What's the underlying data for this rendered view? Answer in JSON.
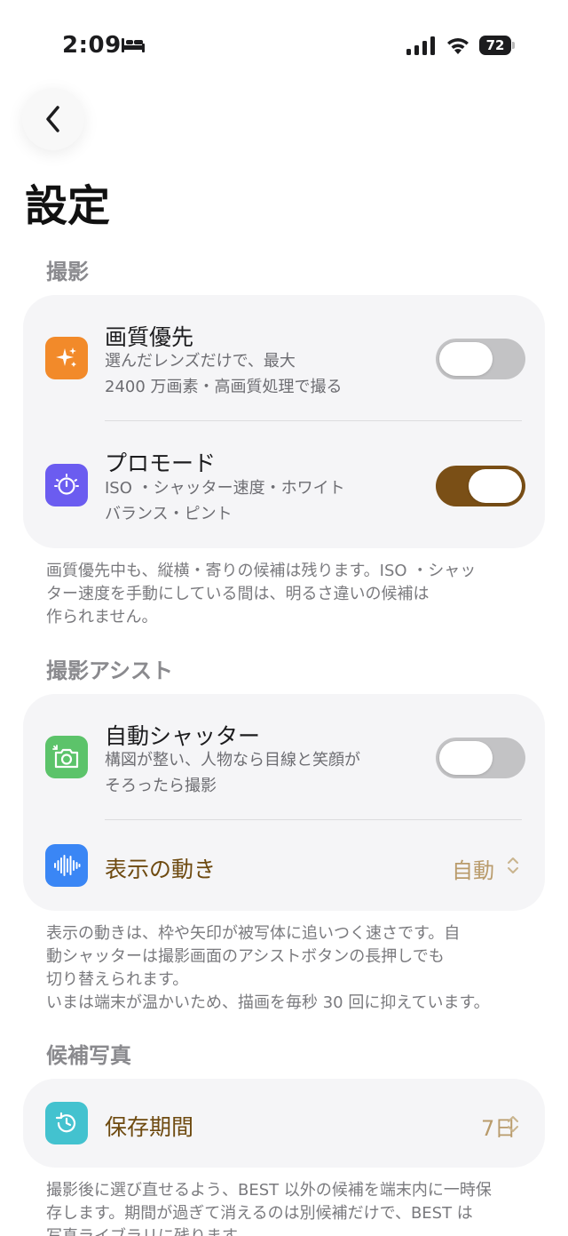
{
  "status_bar": {
    "time": "2:09",
    "battery": "72",
    "icons": [
      "bed-icon",
      "signal-icon",
      "wifi-icon",
      "battery-icon"
    ]
  },
  "back_icon": "chevron-left-icon",
  "page_title": "設定",
  "sections": {
    "shooting": {
      "header": "撮影",
      "items": {
        "quality": {
          "icon": "sparkles-icon",
          "icon_color": "#f28a2a",
          "title": "画質優先",
          "desc_line1": "選んだレンズだけで、最大",
          "desc_line2": "2400 万画素・高画質処理で撮る",
          "enabled": false
        },
        "pro": {
          "icon": "timer-icon",
          "icon_color": "#6b5cf0",
          "title": "プロモード",
          "desc_line1": "ISO ・シャッター速度・ホワイト",
          "desc_line2": "バランス・ピント",
          "enabled": true
        }
      },
      "note_lines": [
        "画質優先中も、縦横・寄りの候補は残ります。ISO ・シャッ",
        "ター速度を手動にしている間は、明るさ違いの候補は",
        "作られません。"
      ]
    },
    "assist": {
      "header": "撮影アシスト",
      "items": {
        "auto_shutter": {
          "icon": "camera-icon",
          "icon_color": "#5cc36a",
          "title": "自動シャッター",
          "desc_line1": "構図が整い、人物なら目線と笑顔が",
          "desc_line2": "そろったら撮影",
          "enabled": false
        },
        "motion": {
          "icon": "waveform-icon",
          "icon_color": "#3a86f5",
          "title": "表示の動き",
          "value": "自動"
        }
      },
      "note_lines": [
        "表示の動きは、枠や矢印が被写体に追いつく速さです。自",
        "動シャッターは撮影画面のアシストボタンの長押しでも",
        "切り替えられます。",
        "いまは端末が温かいため、描画を毎秒 30 回に抑えています。"
      ]
    },
    "candidates": {
      "header": "候補写真",
      "items": {
        "retention": {
          "icon": "history-icon",
          "icon_color": "#43c2cf",
          "title": "保存期間",
          "value": "7日"
        }
      },
      "note_lines": [
        "撮影後に選び直せるよう、BEST 以外の候補を端末内に一時保",
        "存します。期間が過ぎて消えるのは別候補だけで、BEST は",
        "写真ライブラリに残ります。"
      ]
    }
  },
  "colors": {
    "accent_brown": "#7a4f16",
    "value_tan": "#b99b6b",
    "card_bg": "#f5f5f7"
  }
}
